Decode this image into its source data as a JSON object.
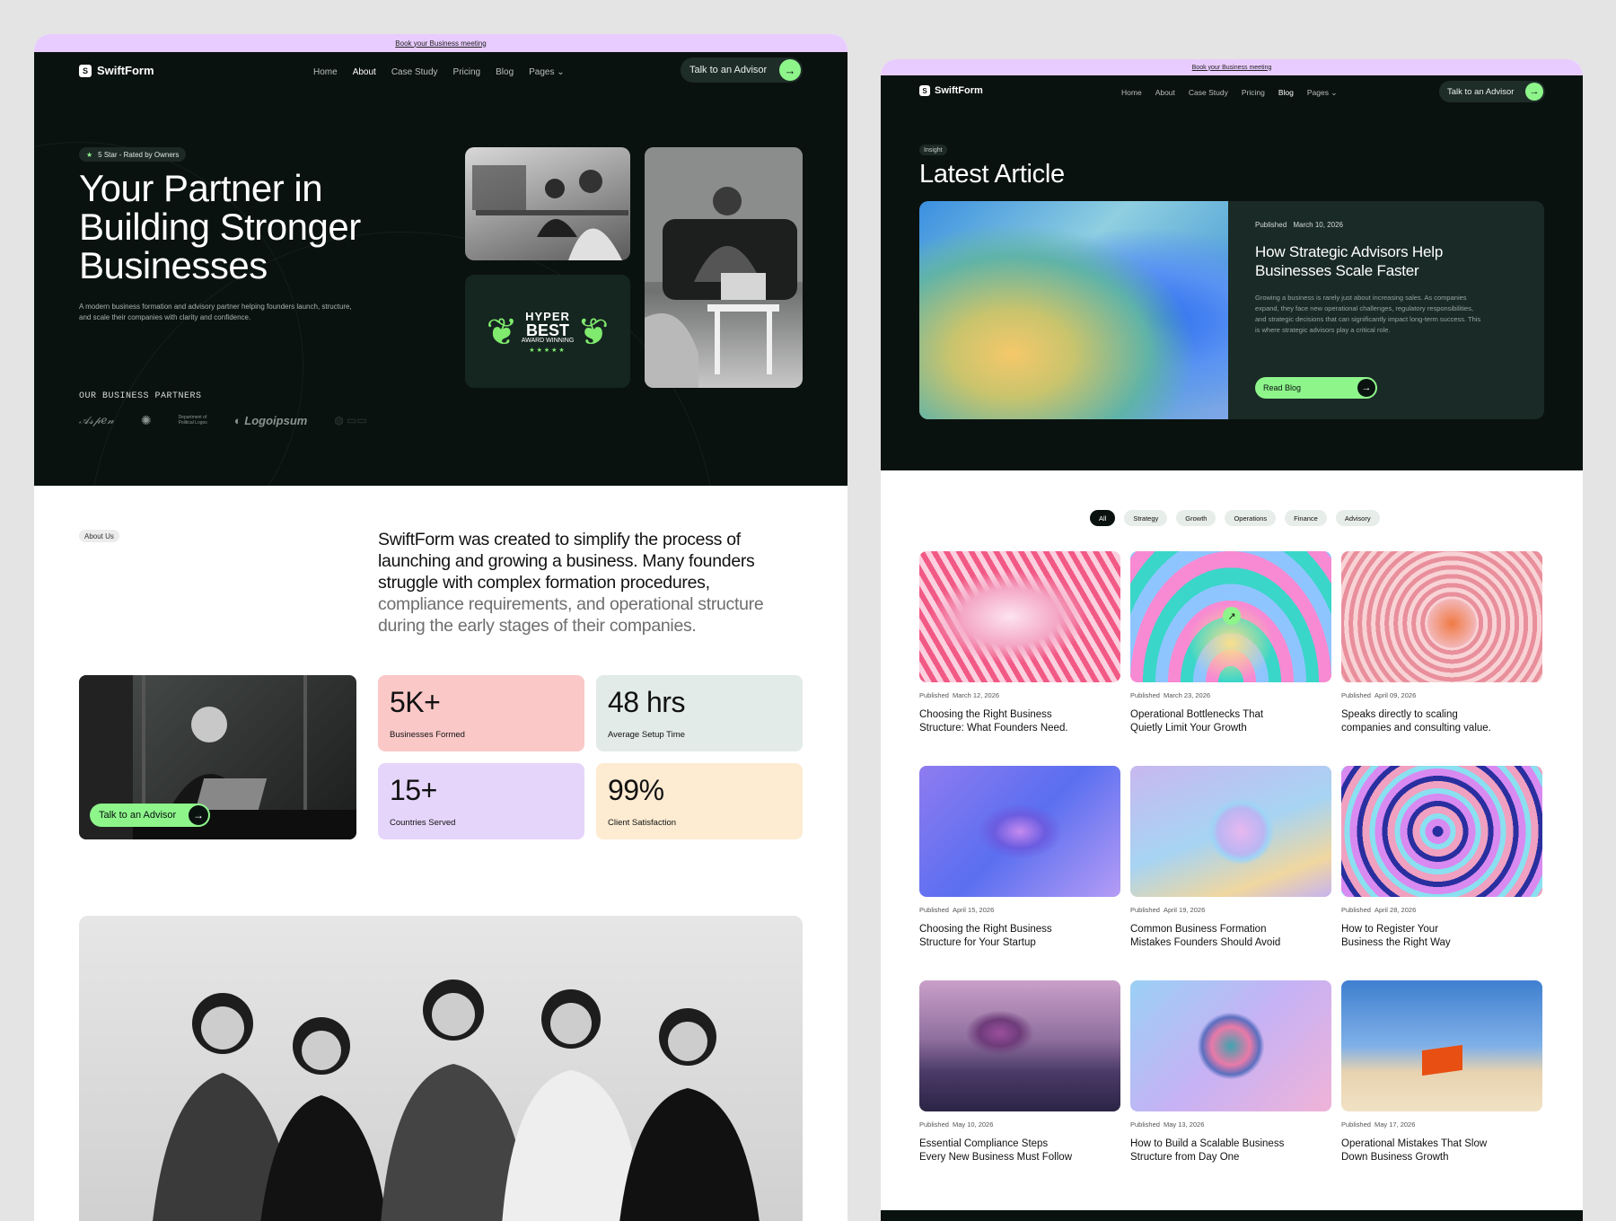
{
  "left_page": {
    "topbar": "Book your Business meeting",
    "logo": "SwiftForm",
    "nav": [
      "Home",
      "About",
      "Case Study",
      "Pricing",
      "Blog",
      "Pages"
    ],
    "active_nav": "About",
    "cta": "Talk to an Advisor",
    "hero": {
      "badge": "5 Star - Rated by Owners",
      "title_l1": "Your Partner in",
      "title_l2": "Building Stronger",
      "title_l3": "Businesses",
      "subtitle_l1": "A modern business formation and advisory partner helping founders launch, structure,",
      "subtitle_l2": "and scale their companies with clarity and confidence.",
      "partners_label": "OUR BUSINESS PARTNERS",
      "partner_logo_text": "Logoipsum",
      "award_l1": "HYPER",
      "award_l2": "BEST",
      "award_l3": "AWARD WINNING",
      "award_stars": "★★★★★"
    },
    "about": {
      "tag": "About Us",
      "dark_l1": "SwiftForm was created to simplify the process of",
      "dark_l2": "launching and growing a business. Many founders",
      "dark_l3": "struggle with complex formation procedures,",
      "grey_l4": "compliance requirements, and operational structure",
      "grey_l5": "during the early stages of their companies.",
      "photo_cta": "Talk to an Advisor"
    },
    "stats": [
      {
        "value": "5K+",
        "label": "Businesses Formed",
        "color": "#fbc8c8"
      },
      {
        "value": "48 hrs",
        "label": "Average Setup Time",
        "color": "#e2ebe8"
      },
      {
        "value": "15+",
        "label": "Countries Served",
        "color": "#e6d5fb"
      },
      {
        "value": "99%",
        "label": "Client Satisfaction",
        "color": "#fdebd2"
      }
    ]
  },
  "right_page": {
    "topbar": "Book your Business meeting",
    "logo": "SwiftForm",
    "nav": [
      "Home",
      "About",
      "Case Study",
      "Pricing",
      "Blog",
      "Pages"
    ],
    "active_nav": "Blog",
    "cta": "Talk to an Advisor",
    "insight_tag": "Insight",
    "heading": "Latest Article",
    "featured": {
      "published_label": "Published",
      "date": "March 10, 2026",
      "title_l1": "How Strategic Advisors Help",
      "title_l2": "Businesses Scale Faster",
      "desc_l1": "Growing a business is rarely just about increasing sales. As companies",
      "desc_l2": "expand, they face new operational challenges, regulatory responsibilities,",
      "desc_l3": "and strategic decisions that can significantly impact long-term success. This",
      "desc_l4": "is where strategic advisors play a critical role.",
      "button": "Read Blog"
    },
    "filters": [
      "All",
      "Strategy",
      "Growth",
      "Operations",
      "Finance",
      "Advisory"
    ],
    "active_filter": "All",
    "published_label": "Published",
    "posts": [
      {
        "date": "March 12, 2026",
        "t1": "Choosing the Right Business",
        "t2": "Structure: What Founders Need."
      },
      {
        "date": "March 23, 2026",
        "t1": "Operational Bottlenecks That",
        "t2": "Quietly Limit Your Growth"
      },
      {
        "date": "April 09, 2026",
        "t1": "Speaks directly to scaling",
        "t2": "companies and consulting value."
      },
      {
        "date": "April 15, 2026",
        "t1": "Choosing the Right Business",
        "t2": "Structure for Your Startup"
      },
      {
        "date": "April 19, 2026",
        "t1": "Common Business Formation",
        "t2": "Mistakes Founders Should Avoid"
      },
      {
        "date": "April 28, 2026",
        "t1": "How to Register Your",
        "t2": "Business the Right Way"
      },
      {
        "date": "May 10, 2026",
        "t1": "Essential Compliance Steps",
        "t2": "Every New Business Must Follow"
      },
      {
        "date": "May 13, 2026",
        "t1": "How to Build a Scalable Business",
        "t2": "Structure from Day One"
      },
      {
        "date": "May 17, 2026",
        "t1": "Operational Mistakes That Slow",
        "t2": "Down Business Growth"
      }
    ]
  },
  "colors": {
    "dark": "#0a1210",
    "accent": "#8ef58b",
    "topbar": "#e9ccff",
    "panel": "#1a2a26"
  }
}
